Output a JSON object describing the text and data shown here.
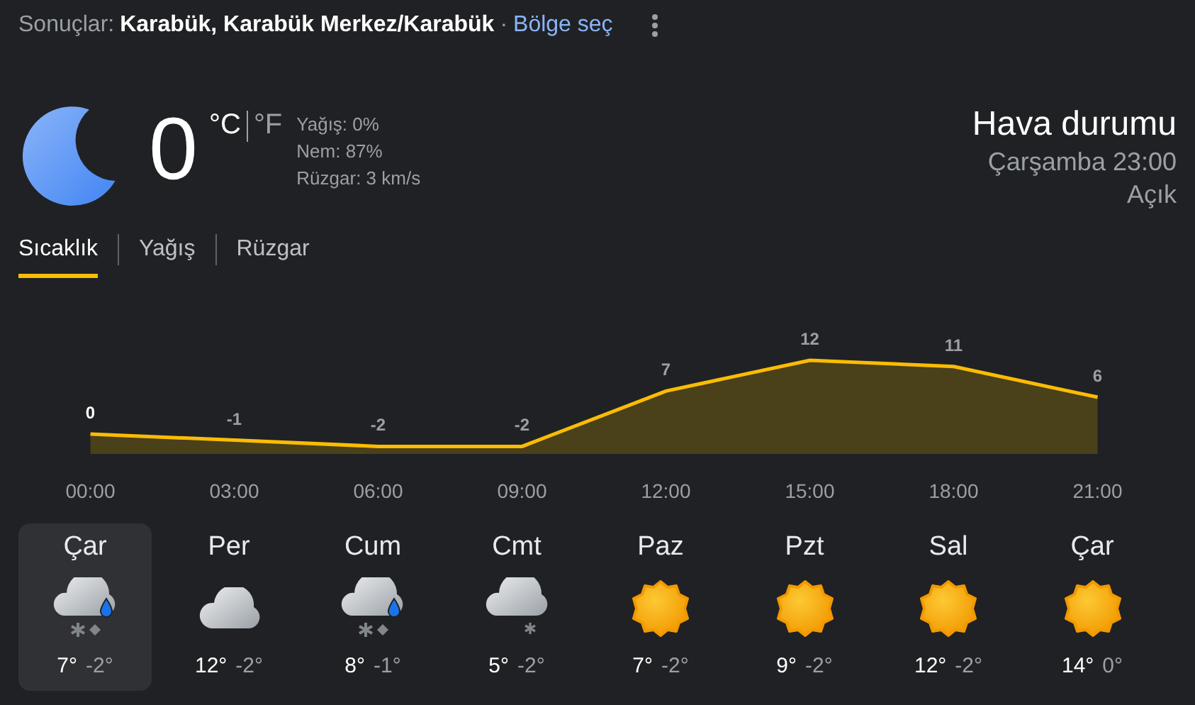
{
  "header": {
    "label": "Sonuçlar:",
    "location": "Karabük, Karabük Merkez/Karabük",
    "separator": "·",
    "link": "Bölge seç"
  },
  "current": {
    "temperature": "0",
    "units": [
      {
        "label": "°C",
        "selected": true
      },
      {
        "label": "°F",
        "selected": false
      }
    ],
    "details": [
      "Yağış: 0%",
      "Nem: 87%",
      "Rüzgar: 3 km/s"
    ]
  },
  "summary": {
    "title": "Hava durumu",
    "time": "Çarşamba 23:00",
    "condition": "Açık"
  },
  "tabs": [
    {
      "label": "Sıcaklık",
      "selected": true
    },
    {
      "label": "Yağış",
      "selected": false
    },
    {
      "label": "Rüzgar",
      "selected": false
    }
  ],
  "chart": {
    "chart_data": {
      "type": "area",
      "categories": [
        "00:00",
        "03:00",
        "06:00",
        "09:00",
        "12:00",
        "15:00",
        "18:00",
        "21:00"
      ],
      "series": [
        {
          "color": "#fbbc04",
          "values": [
            0,
            -1,
            -2,
            -2,
            7,
            12,
            11,
            6
          ]
        }
      ],
      "data_labels": true
    }
  },
  "days": [
    {
      "name": "Çar",
      "kind": "sleet",
      "high": "7°",
      "low": "-2°",
      "selected": true
    },
    {
      "name": "Per",
      "kind": "cloudy",
      "high": "12°",
      "low": "-2°",
      "selected": false
    },
    {
      "name": "Cum",
      "kind": "sleet",
      "high": "8°",
      "low": "-1°",
      "selected": false
    },
    {
      "name": "Cmt",
      "kind": "snow",
      "high": "5°",
      "low": "-2°",
      "selected": false
    },
    {
      "name": "Paz",
      "kind": "sunny",
      "high": "7°",
      "low": "-2°",
      "selected": false
    },
    {
      "name": "Pzt",
      "kind": "sunny",
      "high": "9°",
      "low": "-2°",
      "selected": false
    },
    {
      "name": "Sal",
      "kind": "sunny",
      "high": "12°",
      "low": "-2°",
      "selected": false
    },
    {
      "name": "Çar",
      "kind": "sunny",
      "high": "14°",
      "low": "0°",
      "selected": false
    }
  ]
}
